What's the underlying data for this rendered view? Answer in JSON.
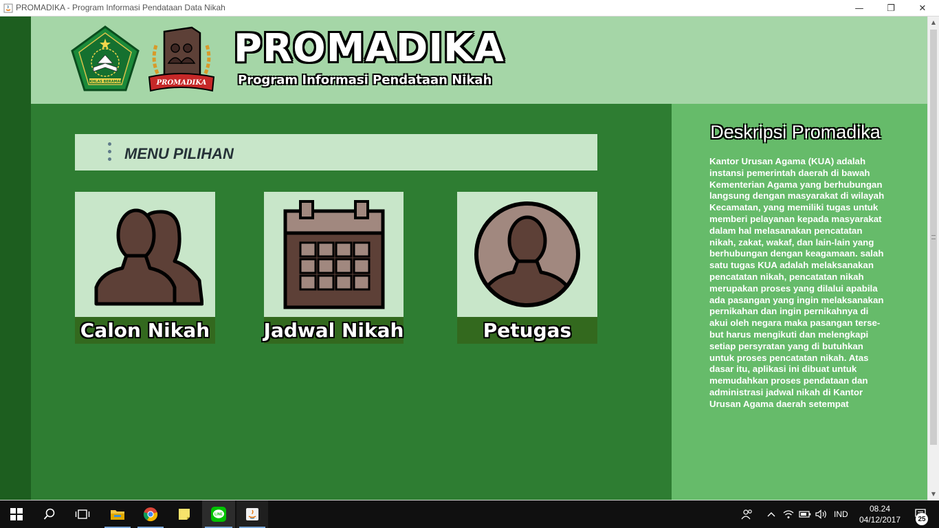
{
  "window": {
    "title": "PROMADIKA - Program Informasi Pendataan Data Nikah",
    "minimize": "—",
    "maximize": "❐",
    "close": "✕"
  },
  "header": {
    "brand_title": "PROMADIKA",
    "brand_subtitle": "Program Informasi Pendataan Nikah",
    "logo_kemenag_text": "IKHLAS BERAMAL",
    "logo_promadika_text": "PROMADIKA"
  },
  "menu": {
    "header_label": "MENU PILIHAN",
    "items": [
      {
        "label": "Calon Nikah",
        "icon": "couple-icon"
      },
      {
        "label": "Jadwal Nikah",
        "icon": "calendar-icon"
      },
      {
        "label": "Petugas",
        "icon": "officer-icon"
      }
    ]
  },
  "side": {
    "title": "Deskripsi Promadika",
    "lines": [
      "Kantor Urusan Agama (KUA) adalah",
      "instansi pemerintah daerah di bawah",
      "Kementerian Agama yang berhubungan",
      "langsung dengan masyarakat di wilayah",
      "Kecamatan, yang memiliki tugas untuk",
      "memberi pelayanan kepada masyarakat",
      "dalam hal melasanakan pencatatan",
      "nikah, zakat, wakaf, dan lain-lain yang",
      "berhubungan dengan keagamaan. salah",
      "satu tugas KUA adalah melaksanakan",
      "pencatatan nikah, pencatatan nikah",
      "merupakan proses yang dilalui apabila",
      "ada pasangan yang ingin melaksanakan",
      "pernikahan dan ingin pernikahnya di",
      "akui oleh negara maka pasangan terse-",
      "but harus mengikuti dan melengkapi",
      "setiap persyratan yang di butuhkan",
      "untuk proses pencatatan nikah. Atas",
      "dasar itu, aplikasi ini dibuat untuk",
      "memudahkan proses pendataan dan",
      "administrasi jadwal nikah di Kantor",
      "Urusan Agama daerah setempat"
    ]
  },
  "taskbar": {
    "language": "IND",
    "time": "08.24",
    "date": "04/12/2017",
    "notification_count": "25",
    "apps": [
      "start-icon",
      "search-icon",
      "task-view-icon",
      "file-explorer-icon",
      "chrome-icon",
      "sticky-notes-icon",
      "line-icon",
      "java-icon"
    ],
    "line_label": "LINE"
  },
  "colors": {
    "header_bg": "#a5d6a7",
    "main_bg": "#2e7d32",
    "side_bg": "#66bb6a",
    "left_strip": "#1d5e1f",
    "card_bg": "#c8e6c9",
    "caption_bg": "#33691e",
    "icon_brown": "#5d4037"
  }
}
